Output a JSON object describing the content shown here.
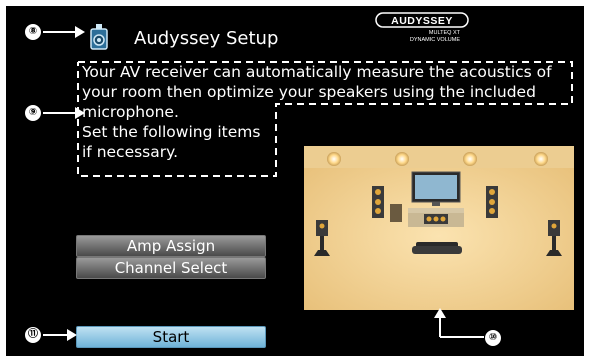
{
  "callouts": {
    "n8": "⑧",
    "n9": "⑨",
    "n10": "⑩",
    "n11": "⑪"
  },
  "header": {
    "title": "Audyssey Setup",
    "icon": "speaker-icon"
  },
  "logo": {
    "brand": "AUDYSSEY",
    "line1": "MULTEQ XT",
    "line2": "DYNAMIC VOLUME"
  },
  "description": {
    "lines": [
      "Your AV receiver can automatically measure the acoustics of",
      "your room then optimize your speakers using the included",
      "microphone.",
      "Set the following items",
      "if necessary."
    ]
  },
  "menu": {
    "amp_assign": "Amp Assign",
    "channel_select": "Channel Select",
    "start": "Start"
  },
  "colors": {
    "background": "#000000",
    "button_gray": "#7a7a7a",
    "button_selected": "#8cc6e6",
    "room_wall": "#f3d9a2"
  }
}
